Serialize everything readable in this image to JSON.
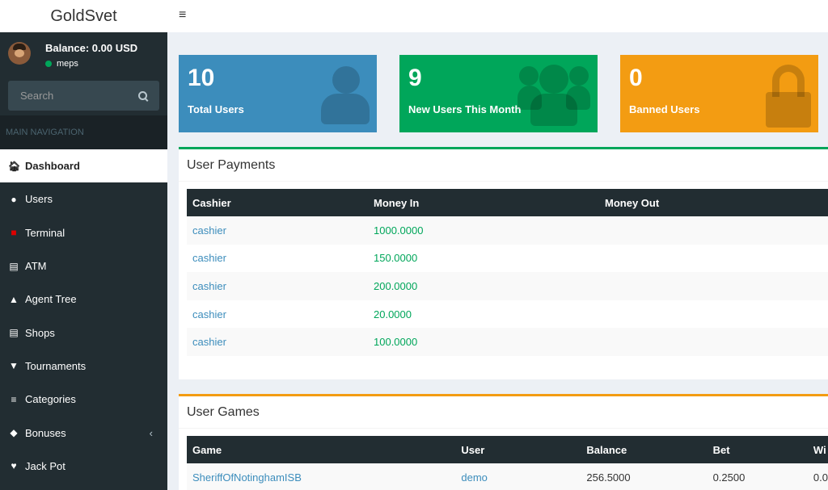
{
  "app": {
    "title": "GoldSvet"
  },
  "sidebar": {
    "balance": "Balance: 0.00 USD",
    "username": "meps",
    "search_placeholder": "Search",
    "nav_header": "MAIN NAVIGATION",
    "items": [
      {
        "label": "Dashboard",
        "icon": "home-icon",
        "active": true
      },
      {
        "label": "Users",
        "icon": "user-icon"
      },
      {
        "label": "Terminal",
        "icon": "desktop-icon"
      },
      {
        "label": "ATM",
        "icon": "credit-card-icon"
      },
      {
        "label": "Agent Tree",
        "icon": "tree-icon"
      },
      {
        "label": "Shops",
        "icon": "bank-icon"
      },
      {
        "label": "Tournaments",
        "icon": "trophy-icon"
      },
      {
        "label": "Categories",
        "icon": "bars-icon"
      },
      {
        "label": "Bonuses",
        "icon": "diamond-icon"
      },
      {
        "label": "Jack Pot",
        "icon": "heart-icon"
      }
    ]
  },
  "stats": {
    "total_users": {
      "value": "10",
      "label": "Total Users"
    },
    "new_users": {
      "value": "9",
      "label": "New Users This Month"
    },
    "banned_users": {
      "value": "0",
      "label": "Banned Users"
    }
  },
  "payments": {
    "title": "User Payments",
    "columns": [
      "Cashier",
      "Money In",
      "Money Out"
    ],
    "rows": [
      {
        "cashier": "cashier",
        "money_in": "1000.0000",
        "money_out": ""
      },
      {
        "cashier": "cashier",
        "money_in": "150.0000",
        "money_out": ""
      },
      {
        "cashier": "cashier",
        "money_in": "200.0000",
        "money_out": ""
      },
      {
        "cashier": "cashier",
        "money_in": "20.0000",
        "money_out": ""
      },
      {
        "cashier": "cashier",
        "money_in": "100.0000",
        "money_out": ""
      }
    ]
  },
  "games": {
    "title": "User Games",
    "columns": [
      "Game",
      "User",
      "Balance",
      "Bet",
      "Wi"
    ],
    "rows": [
      {
        "game": "SheriffOfNotinghamISB",
        "user": "demo",
        "balance": "256.5000",
        "bet": "0.2500",
        "win": "0.0"
      }
    ]
  },
  "colors": {
    "blue": "#3c8dbc",
    "green": "#00a65a",
    "orange": "#f39c12",
    "sidebar": "#222d32"
  }
}
